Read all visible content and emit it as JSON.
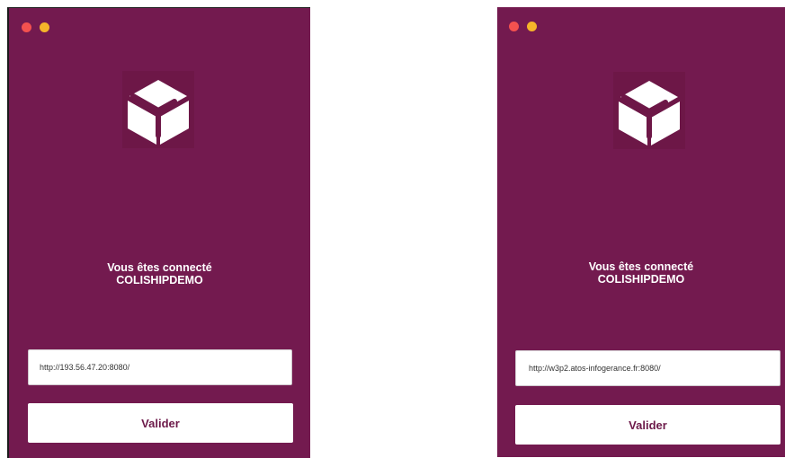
{
  "colors": {
    "background": "#731a4f",
    "close_dot": "#f4514f",
    "minimize_dot": "#f5b52a",
    "button_text": "#6d1a4a"
  },
  "window_left": {
    "logo_icon": "package-box-icon",
    "status_line1": "Vous êtes connecté",
    "status_line2": "COLISHIPDEMO",
    "server_url": "http://193.56.47.20:8080/",
    "valider_label": "Valider"
  },
  "window_right": {
    "logo_icon": "package-box-icon",
    "status_line1": "Vous êtes connecté",
    "status_line2": "COLISHIPDEMO",
    "server_url": "http://w3p2.atos-infogerance.fr:8080/",
    "valider_label": "Valider"
  }
}
